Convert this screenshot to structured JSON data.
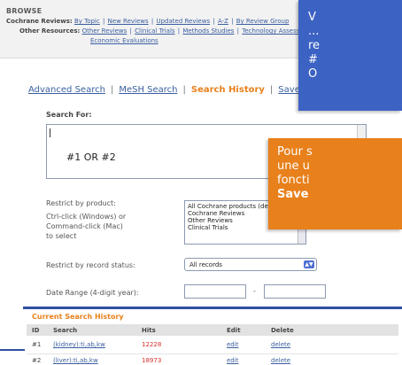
{
  "browse": {
    "title": "BROWSE",
    "row1_label": "Cochrane Reviews:",
    "row1_links": [
      "By Topic",
      "New Reviews",
      "Updated Reviews",
      "A-Z",
      "By Review Group"
    ],
    "row2_label": "Other Resources:",
    "row2_links": [
      "Other Reviews",
      "Clinical Trials",
      "Methods Studies",
      "Technology Assessments"
    ],
    "row3_link": "Economic Evaluations"
  },
  "tabs": {
    "advanced": "Advanced Search",
    "mesh": "MeSH Search",
    "history": "Search History",
    "saved": "Saved Searches",
    "separator": "|"
  },
  "search": {
    "label": "Search For:",
    "query": "#1 OR #2"
  },
  "restrict_product": {
    "label": "Restrict by product:",
    "hint_1": "Ctrl-click (Windows) or",
    "hint_2": "Command-click (Mac)",
    "hint_3": "to select",
    "options": [
      "All Cochrane products (default)",
      "Cochrane Reviews",
      "Other Reviews",
      "Clinical Trials"
    ]
  },
  "restrict_status": {
    "label": "Restrict by record status:",
    "selected": "All records"
  },
  "date_range": {
    "label": "Date Range (4-digit year):",
    "separator": "-"
  },
  "history": {
    "title": "Current Search History",
    "headers": {
      "id": "ID",
      "search": "Search",
      "hits": "Hits",
      "edit": "Edit",
      "delete": "Delete"
    },
    "rows": [
      {
        "id": "#1",
        "search": "(kidney):ti,ab,kw",
        "hits": "12228",
        "edit": "edit",
        "delete": "delete"
      },
      {
        "id": "#2",
        "search": "(liver):ti,ab,kw",
        "hits": "18973",
        "edit": "edit",
        "delete": "delete"
      }
    ]
  },
  "overlay_blue": {
    "lines": [
      "V",
      "...",
      "re",
      "#",
      "O"
    ]
  },
  "overlay_orange": {
    "line1": "Pour s",
    "line2": "une u",
    "line3": "foncti",
    "line4": "Save"
  },
  "colors": {
    "accent_orange": "#e8801b",
    "link_blue": "#3a5fa0",
    "overlay_blue": "#3c62c4",
    "hits_red": "#d9302a",
    "history_border": "#2f4fa0"
  }
}
